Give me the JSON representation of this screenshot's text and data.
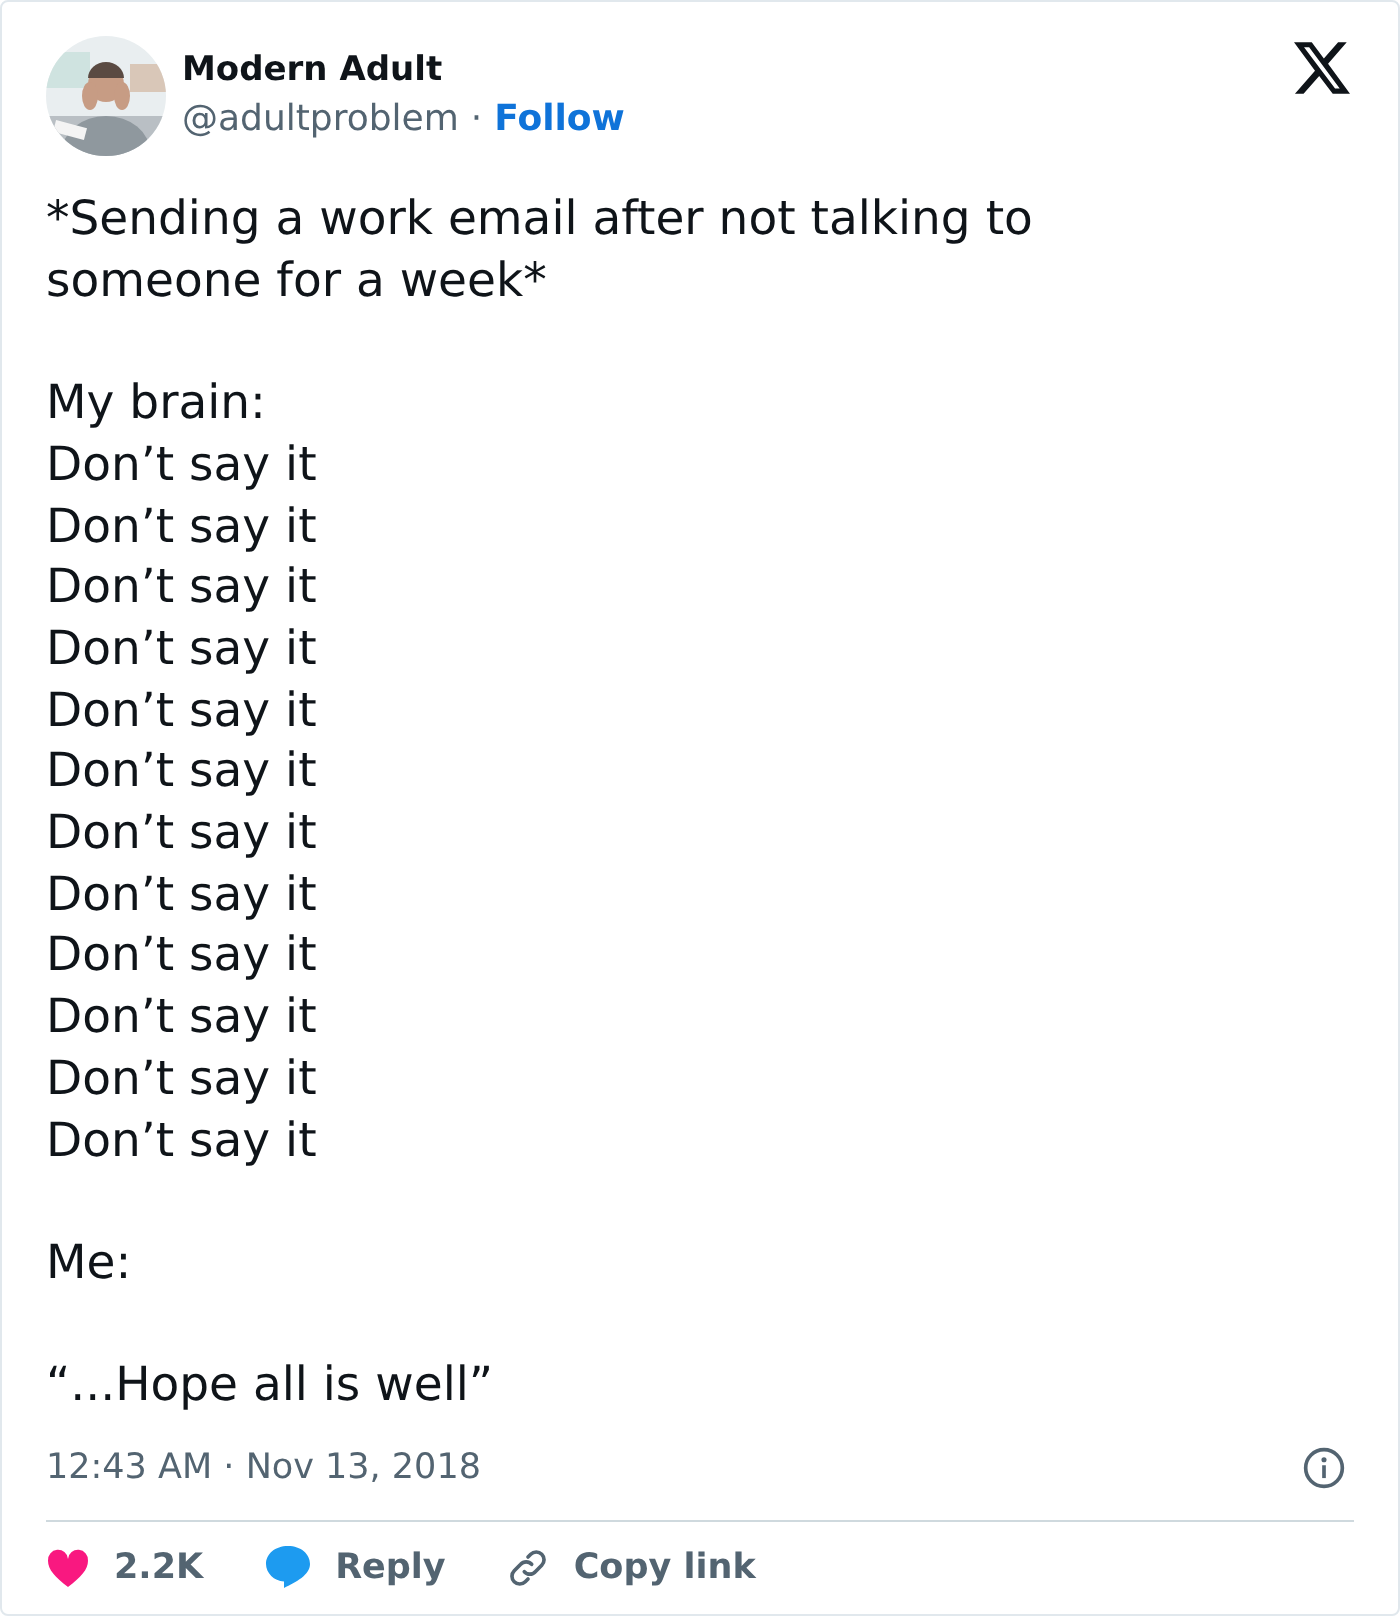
{
  "author": {
    "name": "Modern Adult",
    "handle": "@adultproblem",
    "separator": "·",
    "follow": "Follow"
  },
  "body": [
    [
      "*Sending a work email after not talking to someone for a week*"
    ],
    [
      "My brain:",
      "Don’t say it",
      "Don’t say it",
      "Don’t say it",
      "Don’t say it",
      "Don’t say it",
      "Don’t say it",
      "Don’t say it",
      "Don’t say it",
      "Don’t say it",
      "Don’t say it",
      "Don’t say it",
      "Don’t say it"
    ],
    [
      "Me:"
    ],
    [
      "“...Hope all is well”"
    ]
  ],
  "timestamp": {
    "time": "12:43 AM",
    "separator": "·",
    "date": "Nov 13, 2018"
  },
  "actions": [
    {
      "kind": "like",
      "label": "2.2K"
    },
    {
      "kind": "reply",
      "label": "Reply"
    },
    {
      "kind": "copy",
      "label": "Copy link"
    }
  ]
}
